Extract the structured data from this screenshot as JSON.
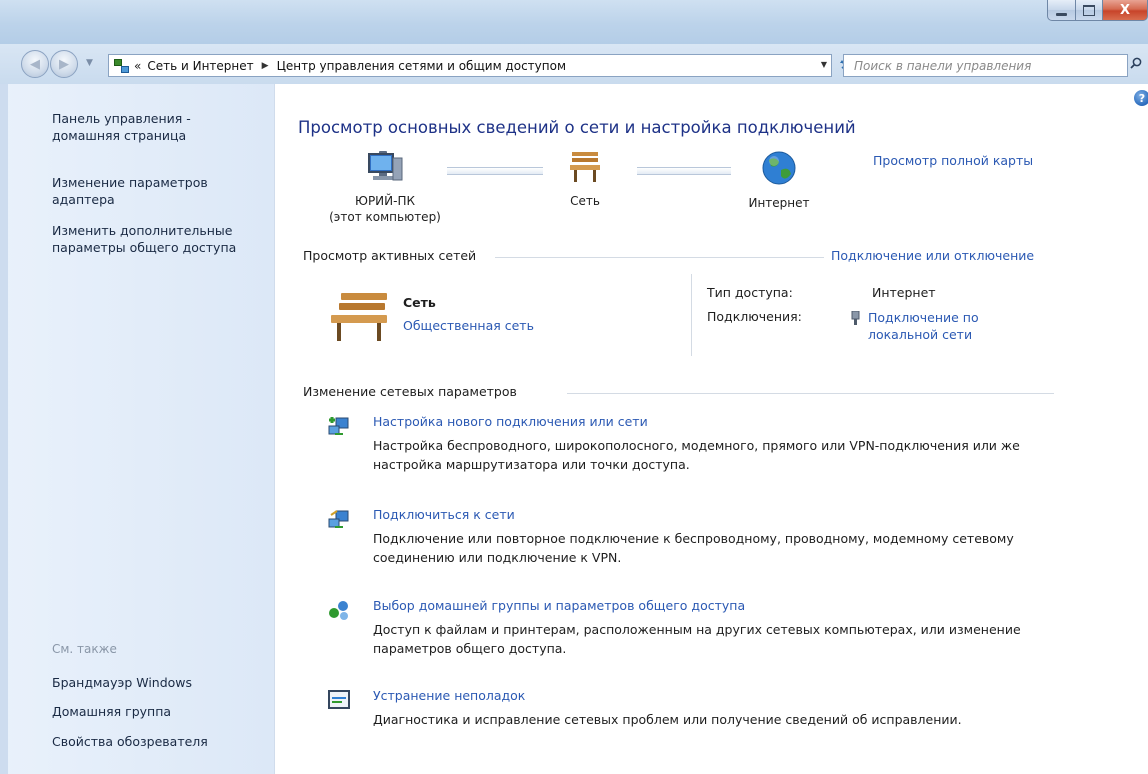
{
  "window": {
    "minimize_glyph": "",
    "maximize_glyph": "",
    "close_glyph": "X"
  },
  "nav": {
    "back_glyph": "◀",
    "forward_glyph": "▶",
    "crumb_more": "«",
    "breadcrumb": [
      "Сеть и Интернет",
      "Центр управления сетями и общим доступом"
    ],
    "search_placeholder": "Поиск в панели управления"
  },
  "sidebar": {
    "home": "Панель управления -\nдомашняя страница",
    "adapter": "Изменение параметров\nадаптера",
    "sharing": "Изменить дополнительные\nпараметры общего доступа",
    "see_also": "См. также",
    "firewall": "Брандмауэр Windows",
    "homegroup": "Домашняя группа",
    "browser": "Свойства обозревателя"
  },
  "main": {
    "heading": "Просмотр основных сведений о сети и настройка подключений",
    "full_map": "Просмотр полной карты",
    "map": {
      "pc": "ЮРИЙ-ПК\n(этот компьютер)",
      "network": "Сеть",
      "internet": "Интернет"
    },
    "active": {
      "title": "Просмотр активных сетей",
      "connect_link": "Подключение или отключение",
      "network_name": "Сеть",
      "network_type": "Общественная сеть",
      "access_label": "Тип доступа:",
      "access_value": "Интернет",
      "connections_label": "Подключения:",
      "connections_value": "Подключение по\nлокальной сети"
    },
    "change": {
      "title": "Изменение сетевых параметров",
      "tasks": [
        {
          "link": "Настройка нового подключения или сети",
          "desc": "Настройка беспроводного, широкополосного, модемного, прямого или VPN-подключения или же настройка маршрутизатора или точки доступа."
        },
        {
          "link": "Подключиться к сети",
          "desc": "Подключение или повторное подключение к беспроводному, проводному, модемному сетевому соединению или подключение к VPN."
        },
        {
          "link": "Выбор домашней группы и параметров общего доступа",
          "desc": "Доступ к файлам и принтерам, расположенным на других сетевых компьютерах, или изменение параметров общего доступа."
        },
        {
          "link": "Устранение неполадок",
          "desc": "Диагностика и исправление сетевых проблем или получение сведений об исправлении."
        }
      ]
    }
  },
  "colors": {
    "link": "#2b59b3",
    "heading": "#1e3287",
    "sidebar_bg": "#dce8f7"
  }
}
